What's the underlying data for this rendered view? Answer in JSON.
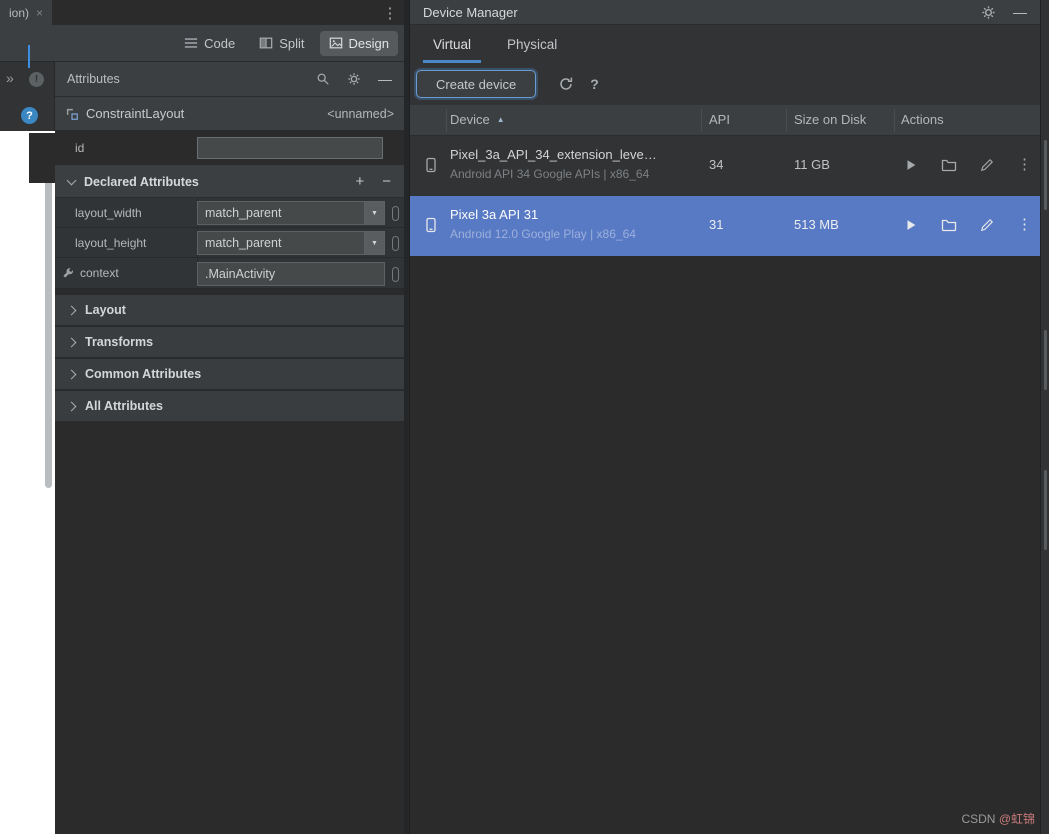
{
  "icons": {
    "close": "×",
    "kebab": "⋮",
    "chevrons": "»",
    "info": "!",
    "help": "?",
    "plus": "+",
    "minus": "−",
    "minimize": "—",
    "sort_asc": "▲",
    "dropdown_arrow": "▼",
    "more": "⋮"
  },
  "editor": {
    "tab_label": "ion)",
    "modes": {
      "code": "Code",
      "split": "Split",
      "design": "Design"
    }
  },
  "attributes_panel": {
    "title": "Attributes",
    "component_name": "ConstraintLayout",
    "component_id": "<unnamed>",
    "id_label": "id",
    "id_value": "",
    "declared_title": "Declared Attributes",
    "attrs": [
      {
        "label": "layout_width",
        "value": "match_parent"
      },
      {
        "label": "layout_height",
        "value": "match_parent"
      },
      {
        "label": "context",
        "value": ".MainActivity"
      }
    ],
    "sections": [
      "Layout",
      "Transforms",
      "Common Attributes",
      "All Attributes"
    ]
  },
  "device_manager": {
    "title": "Device Manager",
    "tab_virtual": "Virtual",
    "tab_physical": "Physical",
    "create_button": "Create device",
    "columns": {
      "device": "Device",
      "api": "API",
      "size": "Size on Disk",
      "actions": "Actions"
    },
    "rows": [
      {
        "name": "Pixel_3a_API_34_extension_leve…",
        "detail": "Android API 34 Google APIs | x86_64",
        "api": "34",
        "size": "11 GB"
      },
      {
        "name": "Pixel 3a API 31",
        "detail": "Android 12.0 Google Play | x86_64",
        "api": "31",
        "size": "513 MB"
      }
    ]
  },
  "watermark": {
    "prefix": "CSDN ",
    "handle": "@虹锦"
  }
}
